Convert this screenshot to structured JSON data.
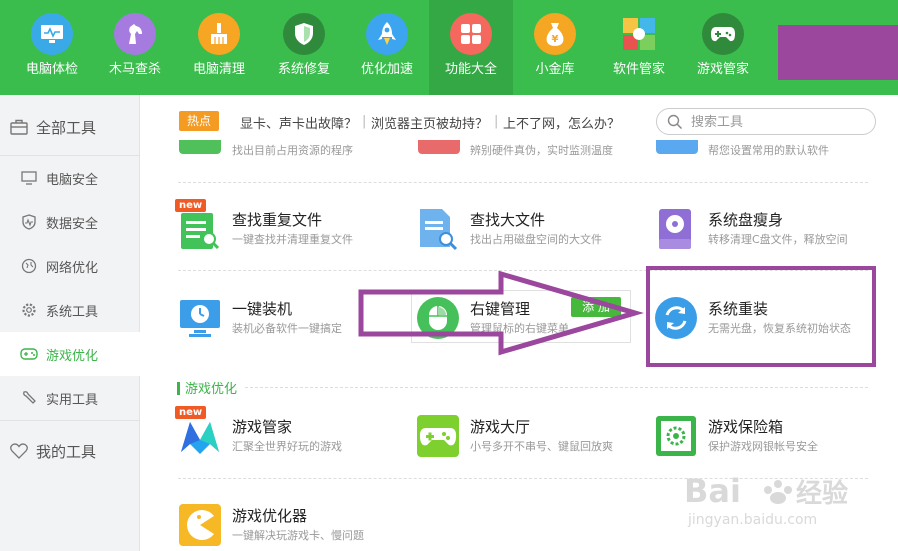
{
  "toolbar": {
    "items": [
      {
        "label": "电脑体检",
        "icon": "monitor-icon",
        "color": "#3aa9e8"
      },
      {
        "label": "木马查杀",
        "icon": "horse-icon",
        "color": "#a57be0"
      },
      {
        "label": "电脑清理",
        "icon": "broom-icon",
        "color": "#f6a623"
      },
      {
        "label": "系统修复",
        "icon": "shield-icon",
        "color": "#2f8a3c"
      },
      {
        "label": "优化加速",
        "icon": "rocket-icon",
        "color": "#3da4ef"
      },
      {
        "label": "功能大全",
        "icon": "grid-icon",
        "color": "#f4685d",
        "active": true
      },
      {
        "label": "小金库",
        "icon": "money-bag-icon",
        "color": "#f5a623"
      },
      {
        "label": "软件管家",
        "icon": "puzzle-icon",
        "color": "#ffffff"
      },
      {
        "label": "游戏管家",
        "icon": "gamepad-icon",
        "color": "#2f8a3c"
      }
    ]
  },
  "sidebar": {
    "all_tools": "全部工具",
    "items": [
      {
        "label": "电脑安全",
        "icon": "monitor-icon"
      },
      {
        "label": "数据安全",
        "icon": "shield-pulse-icon"
      },
      {
        "label": "网络优化",
        "icon": "globe-icon"
      },
      {
        "label": "系统工具",
        "icon": "gear-icon"
      },
      {
        "label": "游戏优化",
        "icon": "gamepad-icon",
        "active": true
      },
      {
        "label": "实用工具",
        "icon": "wrench-icon"
      }
    ],
    "my_tools": "我的工具"
  },
  "hot": {
    "badge": "热点",
    "links": [
      "显卡、声卡出故障？",
      "浏览器主页被劫持？",
      "上不了网，怎么办？"
    ]
  },
  "search": {
    "placeholder": "搜索工具"
  },
  "partial_row": [
    "找出目前占用资源的程序",
    "辨别硬件真伪，实时监测温度",
    "帮您设置常用的默认软件"
  ],
  "tools": {
    "dup_files": {
      "name": "查找重复文件",
      "desc": "一键查找并清理重复文件",
      "badge": "new"
    },
    "big_files": {
      "name": "查找大文件",
      "desc": "找出占用磁盘空间的大文件"
    },
    "sys_slim": {
      "name": "系统盘瘦身",
      "desc": "转移清理C盘文件，释放空间"
    },
    "one_click": {
      "name": "一键装机",
      "desc": "装机必备软件一键搞定"
    },
    "right_menu": {
      "name": "右键管理",
      "desc": "管理鼠标的右键菜单",
      "add_label": "添 加"
    },
    "reinstall": {
      "name": "系统重装",
      "desc": "无需光盘，恢复系统初始状态"
    }
  },
  "game_section": {
    "title": "游戏优化",
    "tools": {
      "game_mgr": {
        "name": "游戏管家",
        "desc": "汇聚全世界好玩的游戏",
        "badge": "new"
      },
      "game_hall": {
        "name": "游戏大厅",
        "desc": "小号多开不串号、键鼠回放爽"
      },
      "game_safe": {
        "name": "游戏保险箱",
        "desc": "保护游戏网银帐号安全"
      },
      "game_opt": {
        "name": "游戏优化器",
        "desc": "一键解决玩游戏卡、慢问题"
      }
    }
  },
  "annotation": {
    "arrow_color": "#9b479e",
    "box_color": "#9b479e"
  },
  "watermark": {
    "brand": "Bai",
    "brand2": "经验",
    "url": "jingyan.baidu.com"
  }
}
